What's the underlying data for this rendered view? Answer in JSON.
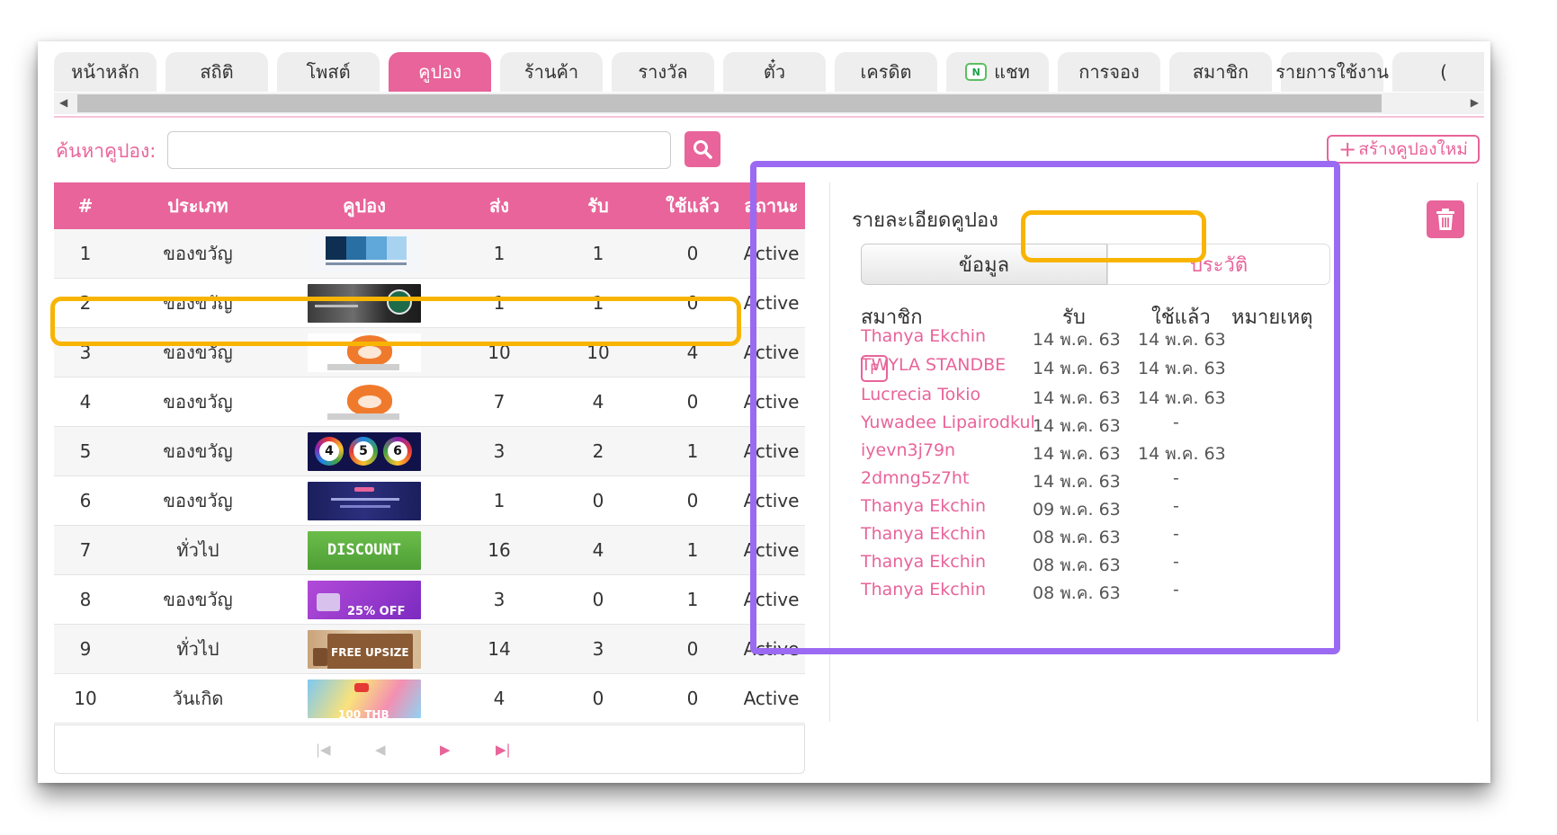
{
  "tabs": [
    {
      "label": "หน้าหลัก",
      "active": false
    },
    {
      "label": "สถิติ",
      "active": false
    },
    {
      "label": "โพสต์",
      "active": false
    },
    {
      "label": "คูปอง",
      "active": true
    },
    {
      "label": "ร้านค้า",
      "active": false
    },
    {
      "label": "รางวัล",
      "active": false
    },
    {
      "label": "ตั๋ว",
      "active": false
    },
    {
      "label": "เครดิต",
      "active": false
    },
    {
      "label": "แชท",
      "active": false,
      "badge": "N"
    },
    {
      "label": "การจอง",
      "active": false
    },
    {
      "label": "สมาชิก",
      "active": false
    },
    {
      "label": "รายการใช้งาน",
      "active": false
    },
    {
      "label": "(",
      "active": false
    }
  ],
  "search": {
    "label": "ค้นหาคูปอง:",
    "value": "",
    "placeholder": "",
    "button_icon": "search-icon"
  },
  "create_button": {
    "plus": "+",
    "label": "สร้างคูปองใหม่"
  },
  "table": {
    "headers": [
      "#",
      "ประเภท",
      "คูปอง",
      "ส่ง",
      "รับ",
      "ใช้แล้ว",
      "สถานะ"
    ],
    "rows": [
      {
        "num": "1",
        "type": "ของขวัญ",
        "image": "blue-swatch",
        "sent": "1",
        "received": "1",
        "used": "0",
        "status": "Active"
      },
      {
        "num": "2",
        "type": "ของขวัญ",
        "image": "coffee-photo",
        "sent": "1",
        "received": "1",
        "used": "0",
        "status": "Active"
      },
      {
        "num": "3",
        "type": "ของขวัญ",
        "image": "cat-mascot",
        "sent": "10",
        "received": "10",
        "used": "4",
        "status": "Active"
      },
      {
        "num": "4",
        "type": "ของขวัญ",
        "image": "cat-mascot",
        "sent": "7",
        "received": "4",
        "used": "0",
        "status": "Active"
      },
      {
        "num": "5",
        "type": "ของขวัญ",
        "image": "balls-456",
        "sent": "3",
        "received": "2",
        "used": "1",
        "status": "Active"
      },
      {
        "num": "6",
        "type": "ของขวัญ",
        "image": "navy-banner",
        "sent": "1",
        "received": "0",
        "used": "0",
        "status": "Active"
      },
      {
        "num": "7",
        "type": "ทั่วไป",
        "image": "discount-green",
        "image_text": "DISCOUNT",
        "sent": "16",
        "received": "4",
        "used": "1",
        "status": "Active"
      },
      {
        "num": "8",
        "type": "ของขวัญ",
        "image": "purple-25off",
        "image_text": "25% OFF",
        "sent": "3",
        "received": "0",
        "used": "1",
        "status": "Active"
      },
      {
        "num": "9",
        "type": "ทั่วไป",
        "image": "free-upsize",
        "image_text": "FREE UPSIZE",
        "sent": "14",
        "received": "3",
        "used": "0",
        "status": "Active"
      },
      {
        "num": "10",
        "type": "วันเกิด",
        "image": "birthday-100thb",
        "image_text": "100 THB",
        "sent": "4",
        "received": "0",
        "used": "0",
        "status": "Active"
      }
    ]
  },
  "pager": [
    "first-page-icon",
    "prev-page-icon",
    "next-page-icon",
    "last-page-icon"
  ],
  "detail": {
    "title": "รายละเอียดคูปอง",
    "tab_info": "ข้อมูล",
    "tab_history": "ประวัติ",
    "history_headers": [
      "สมาชิก",
      "รับ",
      "ใช้แล้ว",
      "หมายเหตุ"
    ],
    "history_rows": [
      {
        "member": "Thanya Ekchin",
        "badge": "",
        "received": "14 พ.ค. 63",
        "used": "14 พ.ค. 63"
      },
      {
        "member": "TWYLA STANDBE",
        "badge": "P",
        "received": "14 พ.ค. 63",
        "used": "14 พ.ค. 63"
      },
      {
        "member": "Lucrecia Tokio",
        "badge": "",
        "received": "14 พ.ค. 63",
        "used": "14 พ.ค. 63"
      },
      {
        "member": "Yuwadee Lipairodkul",
        "badge": "",
        "received": "14 พ.ค. 63",
        "used": "-"
      },
      {
        "member": "iyevn3j79n",
        "badge": "",
        "received": "14 พ.ค. 63",
        "used": "14 พ.ค. 63"
      },
      {
        "member": "2dmng5z7ht",
        "badge": "",
        "received": "14 พ.ค. 63",
        "used": "-"
      },
      {
        "member": "Thanya Ekchin",
        "badge": "",
        "received": "09 พ.ค. 63",
        "used": "-"
      },
      {
        "member": "Thanya Ekchin",
        "badge": "",
        "received": "08 พ.ค. 63",
        "used": "-"
      },
      {
        "member": "Thanya Ekchin",
        "badge": "",
        "received": "08 พ.ค. 63",
        "used": "-"
      },
      {
        "member": "Thanya Ekchin",
        "badge": "",
        "received": "08 พ.ค. 63",
        "used": "-"
      }
    ]
  },
  "colors": {
    "accent": "#e8649a",
    "highlight": "#f8b400",
    "panel_outline": "#9b6af2"
  }
}
